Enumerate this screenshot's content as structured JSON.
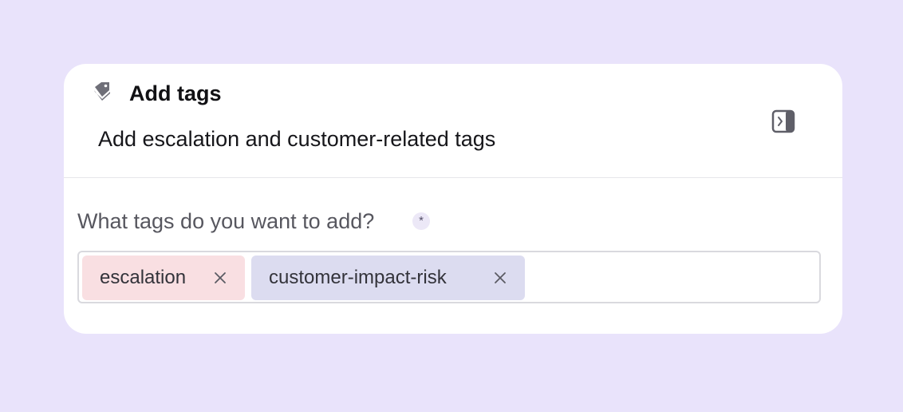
{
  "card": {
    "title": "Add tags",
    "subtitle": "Add escalation and customer-related tags",
    "title_icon": "tag-icon",
    "expand_icon": "panel-expand-icon"
  },
  "field": {
    "label": "What tags do you want to add?",
    "required_marker": "*",
    "tags": [
      {
        "label": "escalation",
        "color": "#f9dfe2",
        "remove_icon": "close-icon"
      },
      {
        "label": "customer-impact-risk",
        "color": "#dcdcf0",
        "remove_icon": "close-icon"
      }
    ]
  },
  "colors": {
    "background": "#e9e3fb",
    "card": "#ffffff",
    "tag_escalation": "#f9dfe2",
    "tag_customer": "#dcdcf0"
  }
}
